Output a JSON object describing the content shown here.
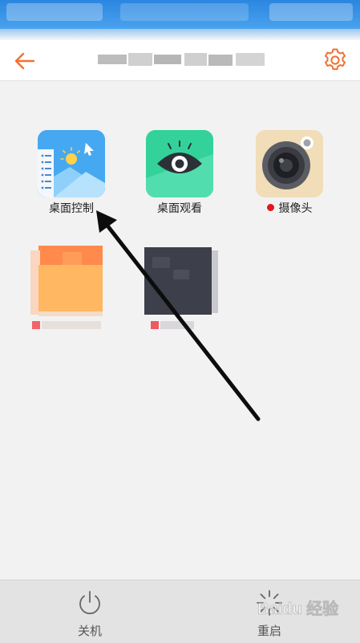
{
  "header": {
    "back_icon": "arrow-left-icon",
    "settings_icon": "gear-icon"
  },
  "grid": {
    "items": [
      {
        "label": "桌面控制",
        "icon": "desktop-control-icon",
        "status_dot": false
      },
      {
        "label": "桌面观看",
        "icon": "eye-icon",
        "status_dot": false
      },
      {
        "label": "摄像头",
        "icon": "camera-icon",
        "status_dot": true
      }
    ]
  },
  "bottom": {
    "shutdown_label": "关机",
    "shutdown_icon": "power-icon",
    "restart_label": "重启",
    "restart_icon": "restart-icon"
  },
  "watermark": {
    "text": "Baidu 经验"
  },
  "colors": {
    "accent": "#f07232",
    "status_bar": "#2a86e0",
    "status_dot": "#e5161c"
  }
}
